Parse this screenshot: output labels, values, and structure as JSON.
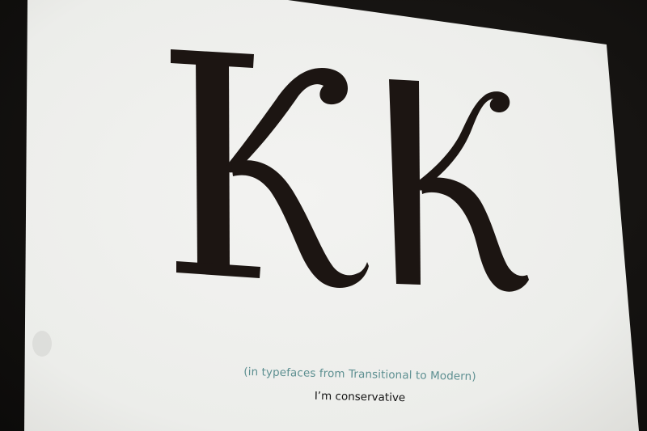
{
  "slide": {
    "subtitle": "(in typefaces from Transitional to Modern)",
    "statement": "I’m conservative",
    "colors": {
      "screen": "#efefed",
      "letters": "#1c1512",
      "subtitle": "#5d8f91",
      "statement": "#141414",
      "surround": "#141210"
    }
  }
}
